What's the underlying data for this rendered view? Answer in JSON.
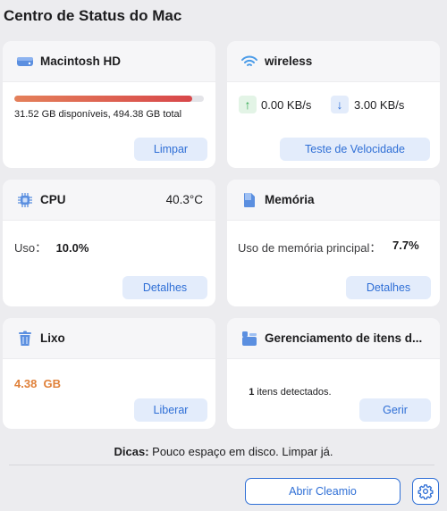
{
  "app": {
    "title": "Centro de Status do Mac"
  },
  "disk": {
    "label": "Macintosh HD",
    "usage_text": "31.52 GB disponíveis, 494.38 GB total",
    "used_fraction": 0.94,
    "button": "Limpar"
  },
  "network": {
    "label": "wireless",
    "upload": "0.00 KB/s",
    "download": "3.00 KB/s",
    "button": "Teste de Velocidade"
  },
  "cpu": {
    "label": "CPU",
    "temperature": "40.3°C",
    "usage_label": "Uso：",
    "usage_value": "10.0%",
    "button": "Detalhes"
  },
  "memory": {
    "label": "Memória",
    "usage_label": "Uso de memória principal：",
    "usage_value": "7.7%",
    "button": "Detalhes"
  },
  "trash": {
    "label": "Lixo",
    "size": "4.38  GB",
    "button": "Liberar"
  },
  "items": {
    "label": "Gerenciamento de itens d...",
    "count": "1",
    "detected_text": " itens detectados.",
    "button": "Gerir"
  },
  "tips": {
    "prefix": "Dicas:",
    "text": " Pouco espaço em disco. Limpar já."
  },
  "footer": {
    "open_button": "Abrir Cleamio"
  },
  "colors": {
    "accent": "#2f6fd6",
    "button_bg": "#e3ecfb",
    "trash_size": "#e0813a",
    "upload_arrow": "#2fa84f",
    "download_arrow": "#2f6fd6"
  }
}
